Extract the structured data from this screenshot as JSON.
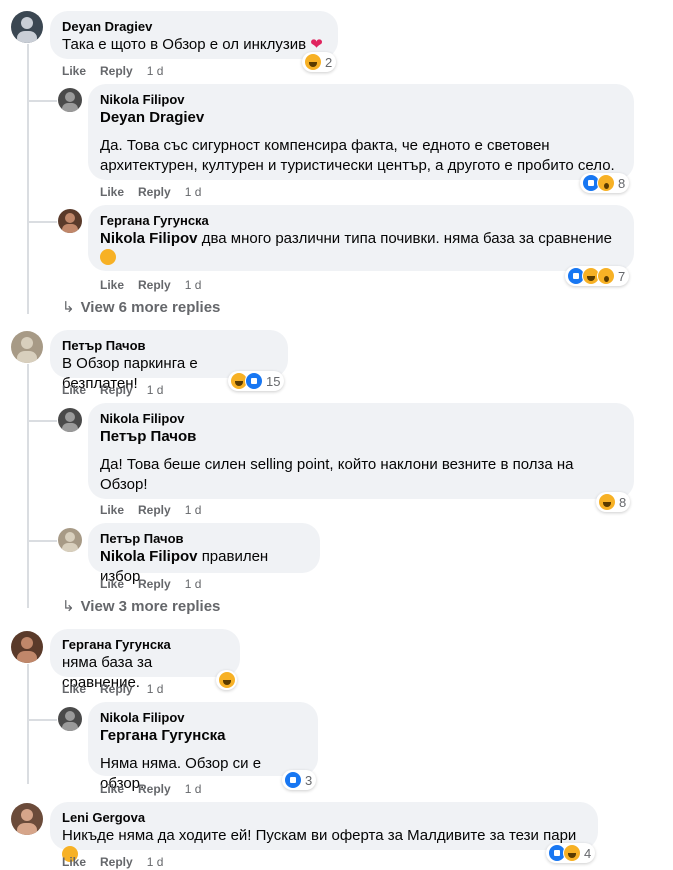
{
  "comments": [
    {
      "author": "Deyan Dragiev",
      "text": "Така е щото в Обзор е ол инклузив",
      "like": "Like",
      "reply": "Reply",
      "time": "1 d",
      "reaction_count": "2",
      "avatar_color": "#3b4752"
    },
    {
      "author": "Nikola Filipov",
      "mention": "Deyan Dragiev",
      "text": "Да. Това със сигурност компенсира факта, че едното е световен архитектурен, културен и туристически център, а другото е пробито село.",
      "like": "Like",
      "reply": "Reply",
      "time": "1 d",
      "reaction_count": "8",
      "avatar_color": "#4a4a4a"
    },
    {
      "author": "Гергана Гугунска",
      "mention": "Nikola Filipov",
      "text": "два много различни типа почивки. няма база за сравнение",
      "like": "Like",
      "reply": "Reply",
      "time": "1 d",
      "reaction_count": "7",
      "avatar_color": "#5a3a2a"
    },
    {
      "view_more": "View 6 more replies"
    },
    {
      "author": "Петър Пачов",
      "text": "В Обзор паркинга е безплатен!",
      "like": "Like",
      "reply": "Reply",
      "time": "1 d",
      "reaction_count": "15",
      "avatar_color": "#a79a86"
    },
    {
      "author": "Nikola Filipov",
      "mention": "Петър Пачов",
      "text": "Да! Това беше силен selling point, който наклони везните в полза на Обзор!",
      "like": "Like",
      "reply": "Reply",
      "time": "1 d",
      "reaction_count": "8",
      "avatar_color": "#4a4a4a"
    },
    {
      "author": "Петър Пачов",
      "mention": "Nikola Filipov",
      "text": "правилен избор",
      "like": "Like",
      "reply": "Reply",
      "time": "1 d",
      "avatar_color": "#a79a86"
    },
    {
      "view_more": "View 3 more replies"
    },
    {
      "author": "Гергана Гугунска",
      "text": "няма база за сравнение.",
      "like": "Like",
      "reply": "Reply",
      "time": "1 d",
      "avatar_color": "#5a3a2a"
    },
    {
      "author": "Nikola Filipov",
      "mention": "Гергана Гугунска",
      "text": "Няма няма. Обзор си е обзор.",
      "like": "Like",
      "reply": "Reply",
      "time": "1 d",
      "reaction_count": "3",
      "avatar_color": "#4a4a4a"
    },
    {
      "author": "Leni Gergova",
      "text": "Никъде няма да ходите ей! Пускам ви оферта за Малдивите за тези пари",
      "like": "Like",
      "reply": "Reply",
      "time": "1 d",
      "reaction_count": "4",
      "avatar_color": "#6b4b3a"
    }
  ]
}
